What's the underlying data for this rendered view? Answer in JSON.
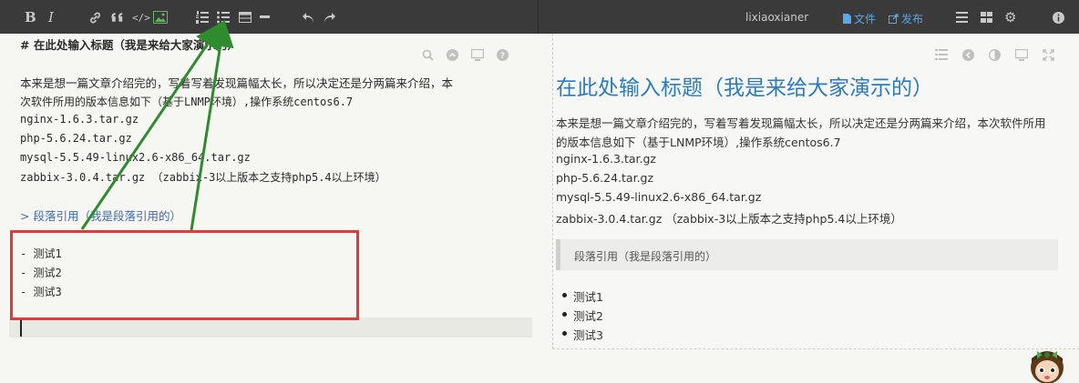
{
  "toolbar": {
    "icons": [
      "bold-icon",
      "italic-icon",
      "link-icon",
      "quote-icon",
      "code-icon",
      "image-icon",
      "ordered-list-icon",
      "unordered-list-icon",
      "table-icon",
      "horizontal-rule-icon",
      "undo-icon",
      "redo-icon"
    ],
    "bold_glyph": "B",
    "italic_glyph": "I",
    "username": "lixiaoxianer",
    "file_label": "文件",
    "publish_label": "发布",
    "accent": "#58a7ea"
  },
  "editor": {
    "lines": {
      "heading": "# 在此处输入标题（我是来给大家演示的）",
      "para1": "    本来是想一篇文章介绍完的，写着写着发现篇幅太长，所以决定还是分两篇来介绍，本",
      "para2": "次软件所用的版本信息如下（基于LNMP环境）,操作系统centos6.7",
      "nginx": "nginx-1.6.3.tar.gz",
      "php": "php-5.6.24.tar.gz",
      "mysql": "mysql-5.5.49-linux2.6-x86_64.tar.gz",
      "zabbix": "zabbix-3.0.4.tar.gz  （zabbix-3以上版本之支持php5.4以上环境）",
      "quote": "> 段落引用（我是段落引用的）",
      "item1": " - 测试1",
      "item2": " - 测试2",
      "item3": " - 测试3"
    }
  },
  "preview": {
    "title": "在此处输入标题（我是来给大家演示的）",
    "para1": "本来是想一篇文章介绍完的，写着写着发现篇幅太长，所以决定还是分两篇来介绍，本次软件所用",
    "para2": "的版本信息如下（基于LNMP环境）,操作系统centos6.7",
    "nginx": "nginx-1.6.3.tar.gz",
    "php": "php-5.6.24.tar.gz",
    "mysql": "mysql-5.5.49-linux2.6-x86_64.tar.gz",
    "zabbix": "zabbix-3.0.4.tar.gz （zabbix-3以上版本之支持php5.4以上环境）",
    "quote": "段落引用（我是段落引用的）",
    "items": [
      "测试1",
      "测试2",
      "测试3"
    ],
    "title_color": "#2a7bbf"
  },
  "annotation": {
    "box_color": "#e53935",
    "arrow_color": "#2e8b2e"
  }
}
